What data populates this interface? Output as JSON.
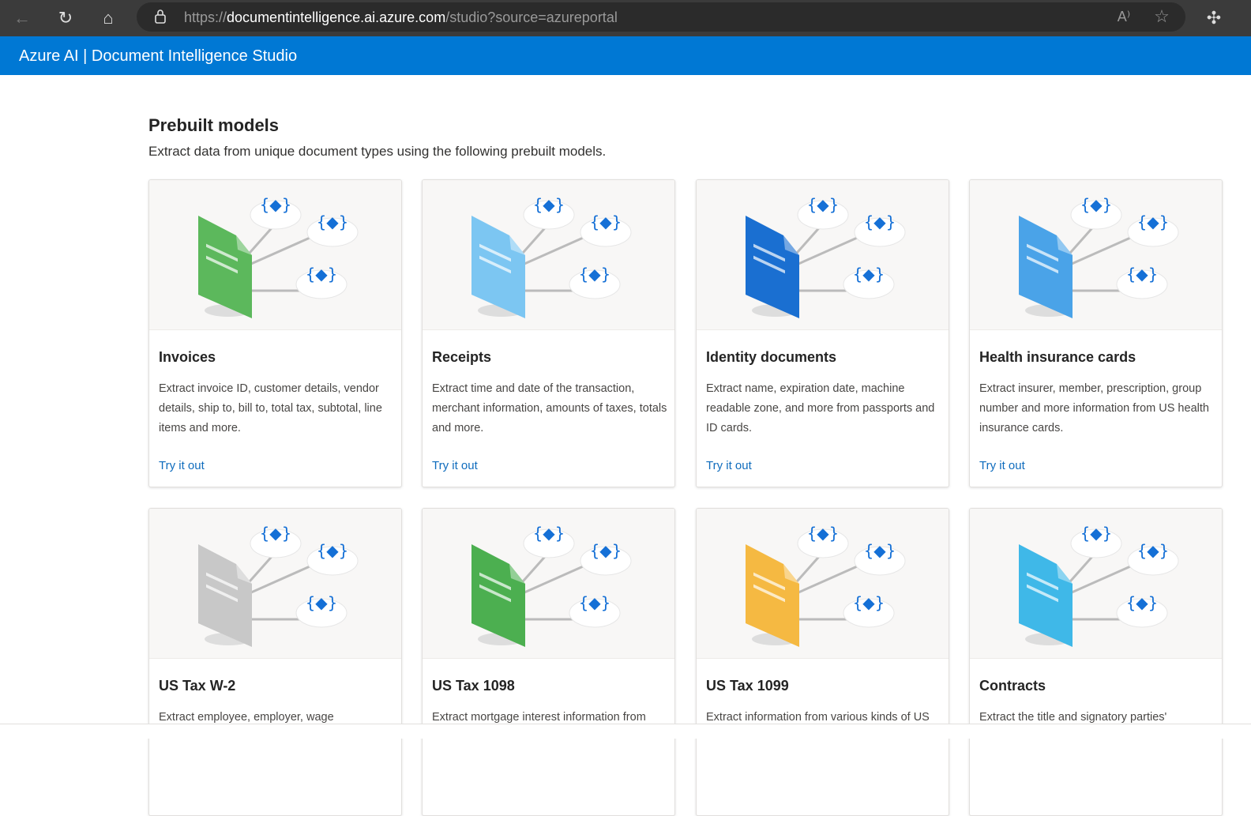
{
  "browser": {
    "url_prefix": "https://",
    "url_host": "documentintelligence.ai.azure.com",
    "url_path": "/studio?source=azureportal"
  },
  "app": {
    "title": "Azure AI | Document Intelligence Studio",
    "accent": "#0078d4"
  },
  "section": {
    "title": "Prebuilt models",
    "subtitle": "Extract data from unique document types using the following prebuilt models."
  },
  "cards": [
    {
      "title": "Invoices",
      "desc": "Extract invoice ID, customer details, vendor details, ship to, bill to, total tax, subtotal, line items and more.",
      "link": "Try it out",
      "color": "#5cb85c"
    },
    {
      "title": "Receipts",
      "desc": "Extract time and date of the transaction, merchant information, amounts of taxes, totals and more.",
      "link": "Try it out",
      "color": "#7cc6f2"
    },
    {
      "title": "Identity documents",
      "desc": "Extract name, expiration date, machine readable zone, and more from passports and ID cards.",
      "link": "Try it out",
      "color": "#1a6fd1"
    },
    {
      "title": "Health insurance cards",
      "desc": "Extract insurer, member, prescription, group number and more information from US health insurance cards.",
      "link": "Try it out",
      "color": "#4aa3e8"
    },
    {
      "title": "US Tax W-2",
      "desc": "Extract employee, employer, wage",
      "color": "#c8c8c8"
    },
    {
      "title": "US Tax 1098",
      "desc": "Extract mortgage interest information from",
      "color": "#4caf50"
    },
    {
      "title": "US Tax 1099",
      "desc": "Extract information from various kinds of US",
      "color": "#f5b942"
    },
    {
      "title": "Contracts",
      "desc": "Extract the title and signatory parties'",
      "color": "#3fb8e8"
    }
  ]
}
